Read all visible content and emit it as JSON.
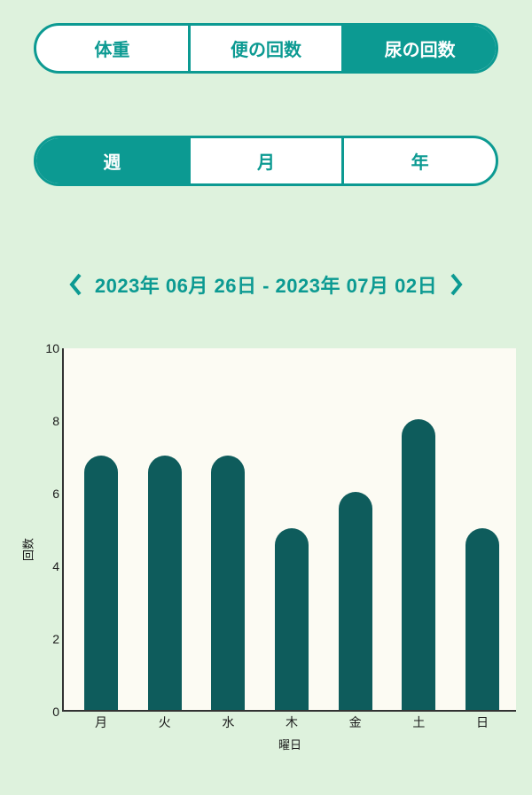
{
  "metric_tabs": {
    "items": [
      {
        "label": "体重",
        "active": false
      },
      {
        "label": "便の回数",
        "active": false
      },
      {
        "label": "尿の回数",
        "active": true
      }
    ]
  },
  "period_tabs": {
    "items": [
      {
        "label": "週",
        "active": true
      },
      {
        "label": "月",
        "active": false
      },
      {
        "label": "年",
        "active": false
      }
    ]
  },
  "date_range": "2023年 06月 26日 - 2023年 07月 02日",
  "chart_data": {
    "type": "bar",
    "categories": [
      "月",
      "火",
      "水",
      "木",
      "金",
      "土",
      "日"
    ],
    "values": [
      7,
      7,
      7,
      5,
      6,
      8,
      5
    ],
    "xlabel": "曜日",
    "ylabel": "回数",
    "ylim": [
      0,
      10
    ],
    "yticks": [
      0,
      2,
      4,
      6,
      8,
      10
    ],
    "bar_color": "#0E5C5C"
  }
}
